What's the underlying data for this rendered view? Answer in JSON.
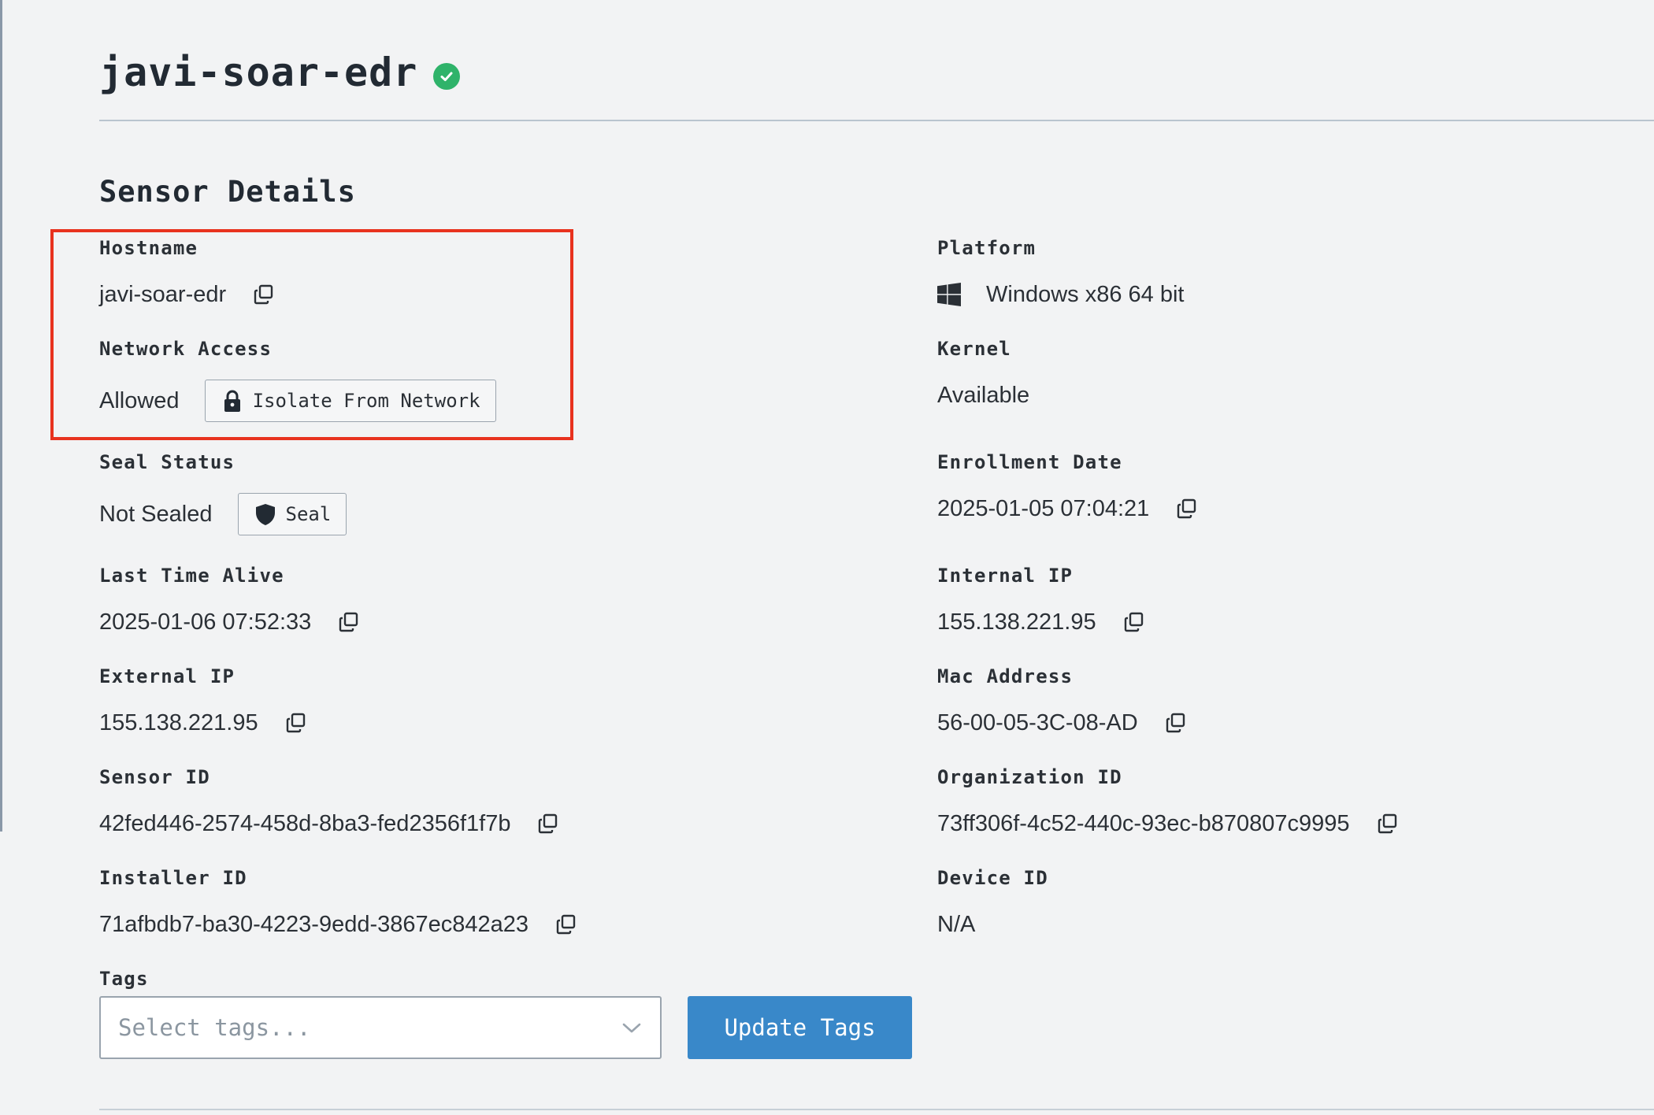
{
  "header": {
    "title": "javi-soar-edr",
    "status_icon": "check-circle-icon",
    "status_color": "#2fb36a"
  },
  "section": {
    "title": "Sensor Details"
  },
  "highlight": {
    "color": "#e8321e"
  },
  "fields": {
    "hostname": {
      "label": "Hostname",
      "value": "javi-soar-edr"
    },
    "network_access": {
      "label": "Network Access",
      "value": "Allowed",
      "button_label": "Isolate From Network",
      "button_icon": "lock-icon"
    },
    "seal_status": {
      "label": "Seal Status",
      "value": "Not Sealed",
      "button_label": "Seal",
      "button_icon": "shield-icon"
    },
    "last_time_alive": {
      "label": "Last Time Alive",
      "value": "2025-01-06 07:52:33"
    },
    "external_ip": {
      "label": "External IP",
      "value": "155.138.221.95"
    },
    "sensor_id": {
      "label": "Sensor ID",
      "value": "42fed446-2574-458d-8ba3-fed2356f1f7b"
    },
    "installer_id": {
      "label": "Installer ID",
      "value": "71afbdb7-ba30-4223-9edd-3867ec842a23"
    },
    "platform": {
      "label": "Platform",
      "value": "Windows x86 64 bit",
      "icon": "windows-icon"
    },
    "kernel": {
      "label": "Kernel",
      "value": "Available"
    },
    "enrollment_date": {
      "label": "Enrollment Date",
      "value": "2025-01-05 07:04:21"
    },
    "internal_ip": {
      "label": "Internal IP",
      "value": "155.138.221.95"
    },
    "mac_address": {
      "label": "Mac Address",
      "value": "56-00-05-3C-08-AD"
    },
    "organization_id": {
      "label": "Organization ID",
      "value": "73ff306f-4c52-440c-93ec-b870807c9995"
    },
    "device_id": {
      "label": "Device ID",
      "value": "N/A"
    }
  },
  "tags": {
    "label": "Tags",
    "placeholder": "Select tags...",
    "update_label": "Update Tags",
    "update_color": "#3988c9"
  }
}
